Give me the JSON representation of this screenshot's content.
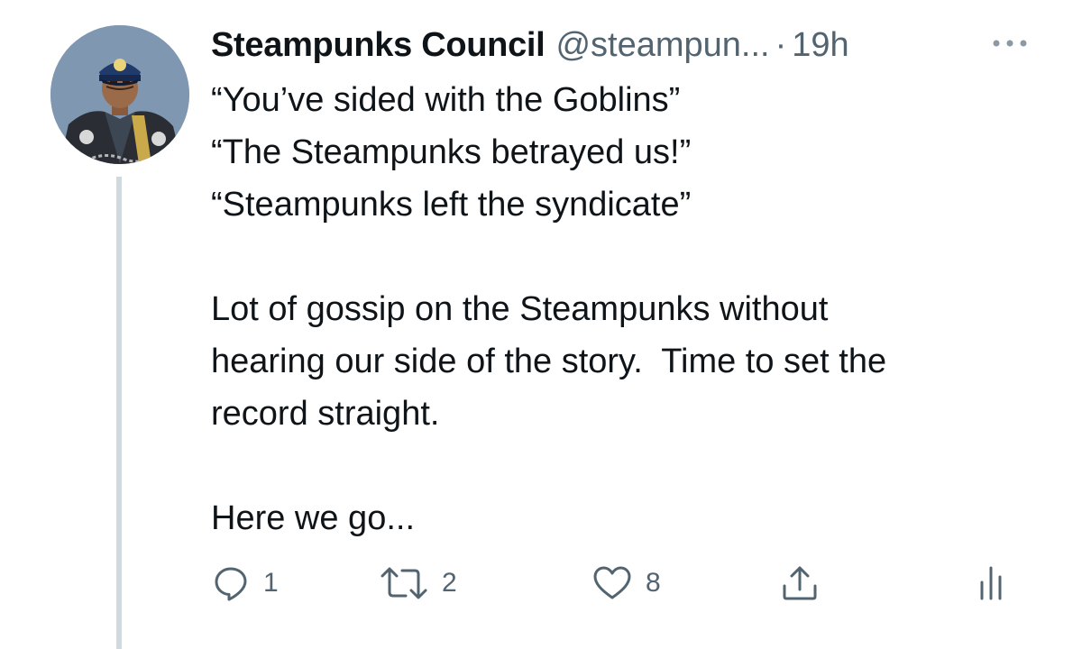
{
  "tweet": {
    "display_name": "Steampunks Council",
    "handle": "@steampun...",
    "separator": "·",
    "time": "19h",
    "lines": [
      "“You’ve sided with the Goblins”",
      "“The Steampunks betrayed us!”",
      "“Steampunks left the syndicate”",
      "",
      "Lot of gossip on the Steampunks without",
      "hearing our side of the story.  Time to set the",
      "record straight.",
      "",
      "Here we go..."
    ],
    "actions": {
      "reply_count": "1",
      "retweet_count": "2",
      "like_count": "8"
    }
  },
  "icons": {
    "more": "more-horizontal-icon",
    "reply": "reply-icon",
    "retweet": "retweet-icon",
    "like": "heart-icon",
    "share": "share-icon",
    "analytics": "analytics-icon"
  },
  "colors": {
    "text": "#0f1419",
    "secondary": "#536471",
    "thread_line": "#cfd9de",
    "icon_light": "#8b98a5"
  }
}
